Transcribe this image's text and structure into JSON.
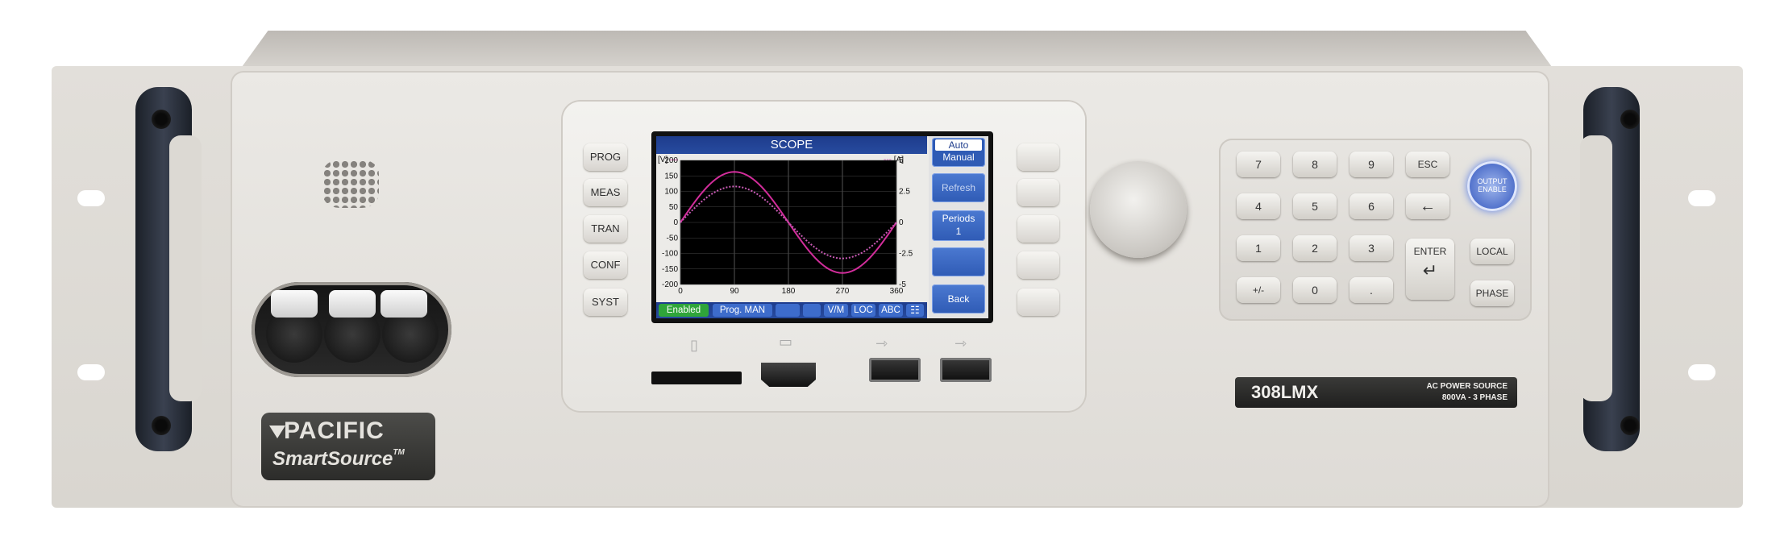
{
  "device": {
    "brand": "PACIFIC",
    "product_line": "SmartSource",
    "trademark": "TM",
    "model": "308LMX",
    "description_line1": "AC POWER SOURCE",
    "description_line2": "800VA - 3 PHASE"
  },
  "side_keys": [
    "PROG",
    "MEAS",
    "TRAN",
    "CONF",
    "SYST"
  ],
  "screen": {
    "title": "SCOPE",
    "left_unit": "[V]",
    "right_unit": "[A]",
    "menu": {
      "auto": "Auto",
      "manual": "Manual",
      "refresh": "Refresh",
      "periods_label": "Periods",
      "periods_value": "1",
      "empty": "",
      "back": "Back"
    },
    "status_bar": {
      "enabled": "Enabled",
      "prog_mode": "Prog. MAN",
      "vm": "V/M",
      "loc": "LOC",
      "abc": "ABC"
    }
  },
  "chart_data": {
    "type": "line",
    "x": [
      0,
      30,
      60,
      90,
      120,
      150,
      180,
      210,
      240,
      270,
      300,
      330,
      360
    ],
    "x_ticks": [
      "0",
      "90",
      "180",
      "270",
      "360"
    ],
    "y_left_ticks": [
      "200",
      "150",
      "100",
      "50",
      "0",
      "-50",
      "-100",
      "-150",
      "-200"
    ],
    "y_right_ticks": [
      "5",
      "2.5",
      "0",
      "-2.5",
      "-5"
    ],
    "ylim_left": [
      -200,
      200
    ],
    "ylim_right": [
      -5,
      5
    ],
    "xlim": [
      0,
      360
    ],
    "grid": true,
    "series": [
      {
        "axis": "left",
        "color": "#d22d9b",
        "values": [
          0,
          82,
          141,
          163,
          141,
          82,
          0,
          -82,
          -141,
          -163,
          -141,
          -82,
          0
        ]
      },
      {
        "axis": "right",
        "color": "#c85ab4",
        "style": "dotted",
        "values": [
          0,
          1.45,
          2.5,
          2.9,
          2.5,
          1.45,
          0,
          -1.45,
          -2.5,
          -2.9,
          -2.5,
          -1.45,
          0
        ]
      }
    ]
  },
  "keypad": {
    "keys": [
      "7",
      "8",
      "9",
      "ESC",
      "4",
      "5",
      "6",
      "←",
      "1",
      "2",
      "3",
      "ENTER",
      "+/-",
      "0",
      ".",
      "LOCAL",
      "PHASE"
    ],
    "output_enable_line1": "OUTPUT",
    "output_enable_line2": "ENABLE"
  },
  "colors": {
    "screen_header": "#274b9f",
    "menu_button": "#3d6ccb",
    "enabled_badge": "#2fa53a",
    "trace": "#d22d9b"
  }
}
